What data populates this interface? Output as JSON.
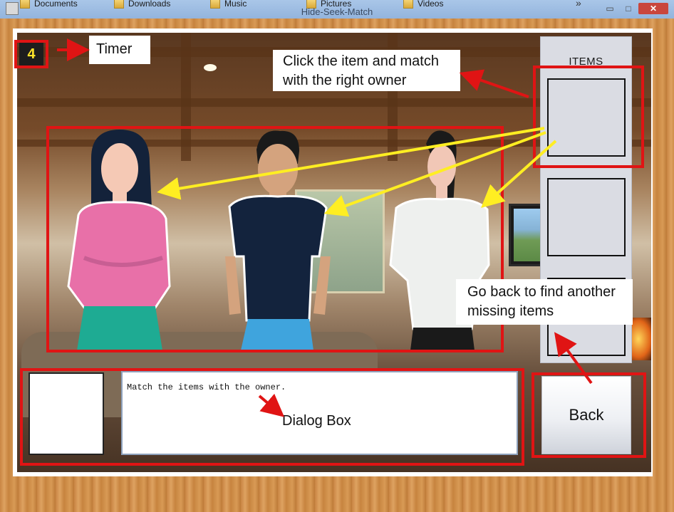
{
  "window": {
    "title": "Hide-Seek-Match",
    "shortcuts": [
      "Documents",
      "Downloads",
      "Music",
      "Pictures",
      "Videos"
    ],
    "overflow_glyph": "»",
    "min_glyph": "▭",
    "max_glyph": "□",
    "close_glyph": "✕"
  },
  "game": {
    "timer_value": "4",
    "items_title": "ITEMS",
    "dialog_text": "Match the items with the owner.",
    "back_label": "Back",
    "item_slots": 3
  },
  "annotations": {
    "timer": "Timer",
    "click_item": "Click the item and match with the right owner",
    "go_back": "Go back to find another missing items",
    "dialog_box": "Dialog Box"
  },
  "colors": {
    "annotation_red": "#e01414",
    "annotation_arrow_yellow": "#ffee22",
    "timer_text": "#ffe42a"
  }
}
